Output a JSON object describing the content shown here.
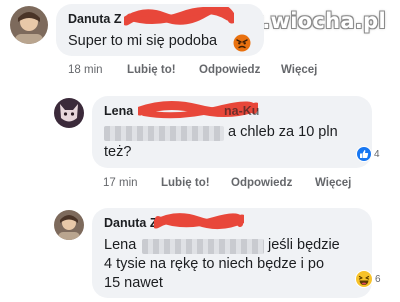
{
  "watermark": "www.wiocha.pl",
  "comments": [
    {
      "author": "Danuta Z",
      "text": "Super to mi się podoba",
      "time": "18 min",
      "like_label": "Lubię to!",
      "reply_label": "Odpowiedz",
      "more_label": "Więcej"
    },
    {
      "author": "Lena",
      "author_suffix": "na-Ku",
      "text_line1": "a chleb za 10 pln",
      "text_line2": "też?",
      "time": "17 min",
      "like_label": "Lubię to!",
      "reply_label": "Odpowiedz",
      "more_label": "Więcej",
      "reaction_count": "4",
      "reaction_icon": "thumbs-up-icon"
    },
    {
      "author": "Danuta Z",
      "text_line1_start": "Lena",
      "text_line1_end": "jeśli będzie",
      "text_line2": "4 tysie na rękę to niech będze i po",
      "text_line3": "15 nawet",
      "reaction_count": "6",
      "reaction_icon": "laughing-emoji-icon"
    }
  ],
  "colors": {
    "bubble": "#f0f2f5",
    "meta_text": "#65676b",
    "like_blue": "#1877f2",
    "scribble_red": "#e8473a",
    "haha_yellow": "#f7c229"
  }
}
